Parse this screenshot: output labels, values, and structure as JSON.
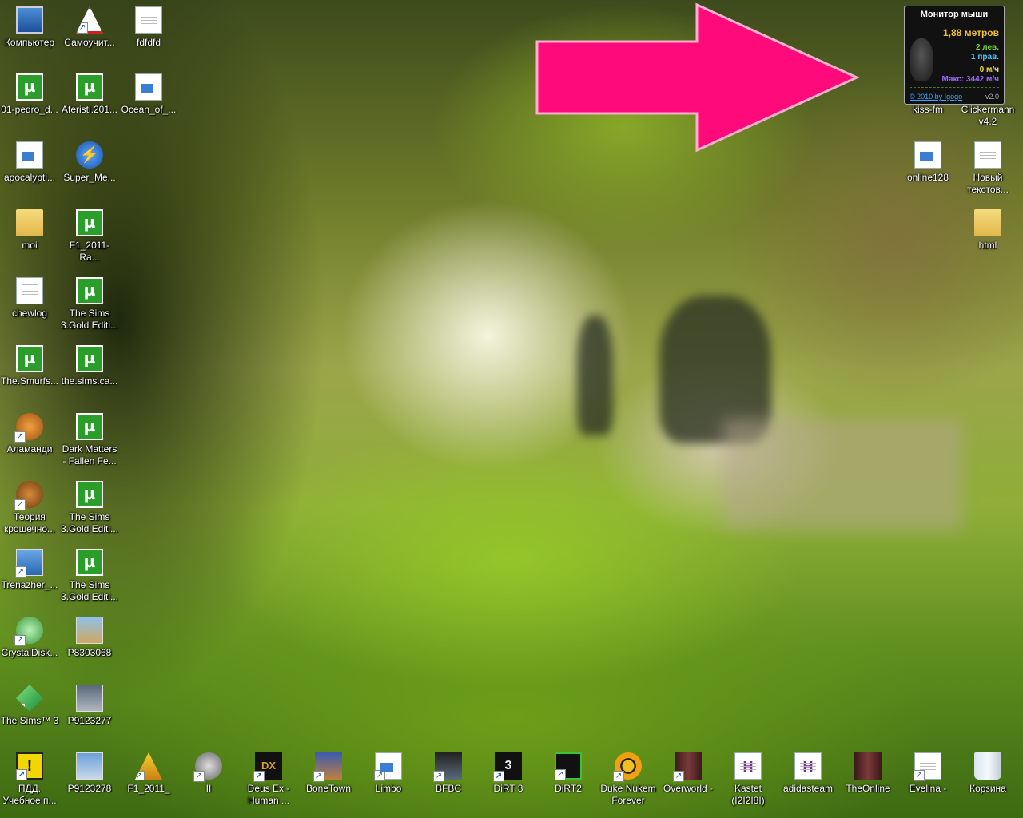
{
  "desktop_icons": {
    "col1": [
      {
        "label": "Компьютер",
        "icon": "computer-icon"
      },
      {
        "label": "01-pedro_d...",
        "icon": "utorrent-icon"
      },
      {
        "label": "apocalypti...",
        "icon": "media-file-icon"
      },
      {
        "label": "moi",
        "icon": "folder-icon"
      },
      {
        "label": "chewlog",
        "icon": "text-file-icon"
      },
      {
        "label": "The.Smurfs...",
        "icon": "utorrent-icon"
      },
      {
        "label": "Аламанди",
        "icon": "app-shortcut-icon"
      },
      {
        "label": "Теория крошечно...",
        "icon": "game-shortcut-icon"
      },
      {
        "label": "Trenazher_...",
        "icon": "installer-icon"
      },
      {
        "label": "CrystalDisk...",
        "icon": "disk-tool-icon"
      },
      {
        "label": "The Sims™ 3",
        "icon": "sims-icon"
      }
    ],
    "col2": [
      {
        "label": "Самоучит...",
        "icon": "road-sign-shortcut-icon"
      },
      {
        "label": "Aferisti.201...",
        "icon": "utorrent-icon"
      },
      {
        "label": "Super_Me...",
        "icon": "flash-icon"
      },
      {
        "label": "F1_2011-Ra...",
        "icon": "utorrent-icon"
      },
      {
        "label": "The Sims 3.Gold Editi...",
        "icon": "utorrent-icon"
      },
      {
        "label": "the.sims.ca...",
        "icon": "utorrent-icon"
      },
      {
        "label": "Dark Matters - Fallen Fe...",
        "icon": "utorrent-icon"
      },
      {
        "label": "The Sims 3.Gold Editi...",
        "icon": "utorrent-icon"
      },
      {
        "label": "The Sims 3.Gold Editi...",
        "icon": "utorrent-icon"
      },
      {
        "label": "P8303068",
        "icon": "image-file-icon"
      },
      {
        "label": "P9123277",
        "icon": "image-file-icon"
      }
    ],
    "col3": [
      {
        "label": "fdfdfd",
        "icon": "text-file-icon"
      },
      {
        "label": "Ocean_of_...",
        "icon": "media-file-icon"
      }
    ],
    "right_col1": [
      {
        "label": "kiss-fm",
        "icon": "app-icon"
      },
      {
        "label": "online128",
        "icon": "media-file-icon"
      }
    ],
    "right_col2": [
      {
        "label": "Clickermann v4.2",
        "icon": "app-icon"
      },
      {
        "label": "Новый текстов...",
        "icon": "text-file-icon"
      },
      {
        "label": "html",
        "icon": "folder-icon"
      }
    ],
    "bottom_row": [
      {
        "label": "ПДД. Учебное п...",
        "icon": "warning-sign-shortcut-icon"
      },
      {
        "label": "P9123278",
        "icon": "image-file-icon"
      },
      {
        "label": "F1_2011_",
        "icon": "f1-shortcut-icon"
      },
      {
        "label": "II",
        "icon": "tank-shortcut-icon"
      },
      {
        "label": "Deus Ex - Human ...",
        "icon": "deus-ex-shortcut-icon"
      },
      {
        "label": "BoneTown",
        "icon": "game-shortcut-icon"
      },
      {
        "label": "Limbo",
        "icon": "media-shortcut-icon"
      },
      {
        "label": "BFBC",
        "icon": "bfbc-shortcut-icon"
      },
      {
        "label": "DiRT 3",
        "icon": "dirt3-shortcut-icon"
      },
      {
        "label": "DiRT2",
        "icon": "dirt2-shortcut-icon"
      },
      {
        "label": "Duke Nukem Forever",
        "icon": "radiation-shortcut-icon"
      },
      {
        "label": "Overworld -",
        "icon": "book-shortcut-icon"
      },
      {
        "label": "Kastet (I2I2I8I)",
        "icon": "h-file-icon"
      },
      {
        "label": "adidasteam",
        "icon": "h-file-icon"
      },
      {
        "label": "TheOnline",
        "icon": "book-icon"
      },
      {
        "label": "Evelina -",
        "icon": "text-shortcut-icon"
      },
      {
        "label": "Корзина",
        "icon": "recycle-bin-icon"
      }
    ]
  },
  "mouse_monitor": {
    "title": "Монитор мыши",
    "distance": "1,88 метров",
    "left_clicks": "2 лев.",
    "right_clicks": "1 прав.",
    "speed": "0 м/ч",
    "max_speed": "Макс: 3442 м/ч",
    "link": "© 2010 by Igogo",
    "version": "v2.0"
  },
  "colors": {
    "arrow": "#ff0a7a",
    "arrow_outline": "#ffb0d0",
    "utorrent": "#2a9d2a"
  }
}
